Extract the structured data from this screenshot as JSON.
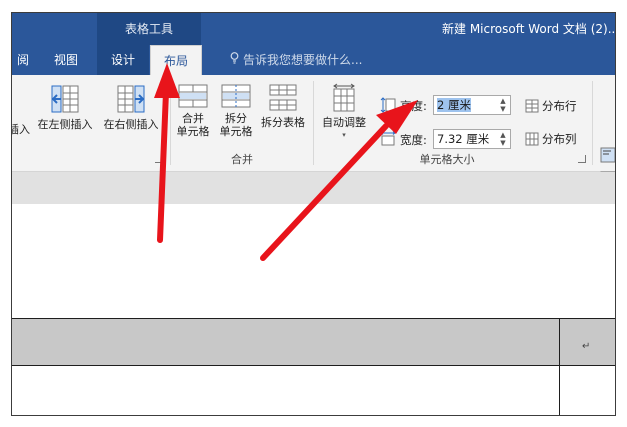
{
  "title_bar": {
    "context_tab_group": "表格工具",
    "window_title": "新建 Microsoft Word 文档 (2)..."
  },
  "tabs": [
    {
      "label": "阅"
    },
    {
      "label": "视图"
    },
    {
      "label": "设计"
    },
    {
      "label": "布局"
    }
  ],
  "tell_me": "告诉我您想要做什么...",
  "ribbon": {
    "insert_left_partial": "插入",
    "insert_left": "在左侧插入",
    "insert_right": "在右侧插入",
    "merge_cells_l1": "合并",
    "merge_cells_l2": "单元格",
    "split_cells_l1": "拆分",
    "split_cells_l2": "单元格",
    "split_table": "拆分表格",
    "group_merge": "合并",
    "autofit": "自动调整",
    "height_label": "高度:",
    "height_value": "2 厘米",
    "width_label": "宽度:",
    "width_value": "7.32 厘米",
    "distribute_rows": "分布行",
    "distribute_cols": "分布列",
    "group_cell_size": "单元格大小"
  },
  "document": {
    "cell_mark": "↵"
  },
  "colors": {
    "ribbon_blue": "#2b579a",
    "context_blue": "#1f4884",
    "annotation_red": "#e8141b",
    "selection": "#9ec3ee"
  }
}
